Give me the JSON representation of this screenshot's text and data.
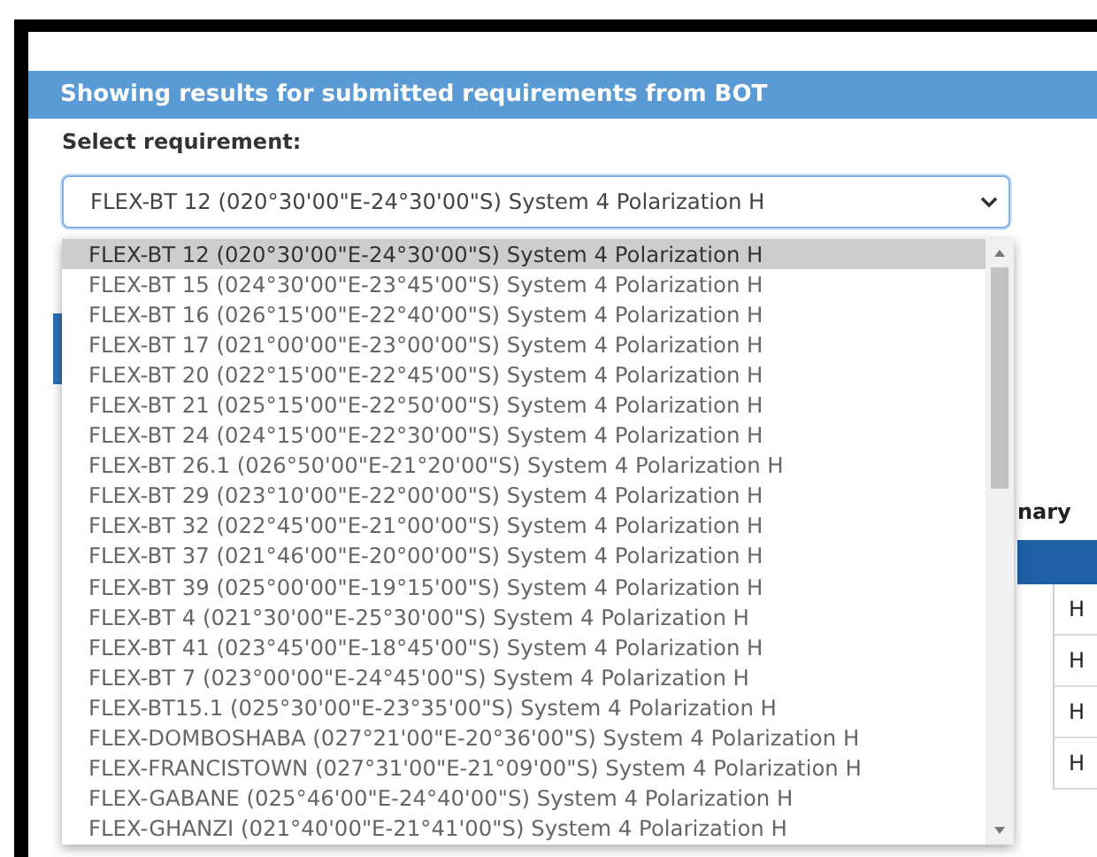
{
  "panel": {
    "title": "Showing results for submitted requirements from BOT"
  },
  "requirement": {
    "label": "Select requirement:",
    "value": "FLEX-BT 12 (020°30'00\"E-24°30'00\"S) System 4 Polarization H"
  },
  "options": [
    {
      "label": "FLEX-BT 12 (020°30'00\"E-24°30'00\"S) System 4 Polarization H",
      "selected": true
    },
    {
      "label": "FLEX-BT 15 (024°30'00\"E-23°45'00\"S) System 4 Polarization H",
      "selected": false
    },
    {
      "label": "FLEX-BT 16 (026°15'00\"E-22°40'00\"S) System 4 Polarization H",
      "selected": false
    },
    {
      "label": "FLEX-BT 17 (021°00'00\"E-23°00'00\"S) System 4 Polarization H",
      "selected": false
    },
    {
      "label": "FLEX-BT 20 (022°15'00\"E-22°45'00\"S) System 4 Polarization H",
      "selected": false
    },
    {
      "label": "FLEX-BT 21 (025°15'00\"E-22°50'00\"S) System 4 Polarization H",
      "selected": false
    },
    {
      "label": "FLEX-BT 24 (024°15'00\"E-22°30'00\"S) System 4 Polarization H",
      "selected": false
    },
    {
      "label": "FLEX-BT 26.1 (026°50'00\"E-21°20'00\"S) System 4 Polarization H",
      "selected": false
    },
    {
      "label": "FLEX-BT 29 (023°10'00\"E-22°00'00\"S) System 4 Polarization H",
      "selected": false
    },
    {
      "label": "FLEX-BT 32 (022°45'00\"E-21°00'00\"S) System 4 Polarization H",
      "selected": false
    },
    {
      "label": "FLEX-BT 37 (021°46'00\"E-20°00'00\"S) System 4 Polarization H",
      "selected": false
    },
    {
      "label": "FLEX-BT 39 (025°00'00\"E-19°15'00\"S) System 4 Polarization H",
      "selected": false
    },
    {
      "label": "FLEX-BT 4 (021°30'00\"E-25°30'00\"S) System 4 Polarization H",
      "selected": false
    },
    {
      "label": "FLEX-BT 41 (023°45'00\"E-18°45'00\"S) System 4 Polarization H",
      "selected": false
    },
    {
      "label": "FLEX-BT 7 (023°00'00\"E-24°45'00\"S) System 4 Polarization H",
      "selected": false
    },
    {
      "label": "FLEX-BT15.1 (025°30'00\"E-23°35'00\"S) System 4 Polarization H",
      "selected": false
    },
    {
      "label": "FLEX-DOMBOSHABA (027°21'00\"E-20°36'00\"S) System 4 Polarization H",
      "selected": false
    },
    {
      "label": "FLEX-FRANCISTOWN (027°31'00\"E-21°09'00\"S) System 4 Polarization H",
      "selected": false
    },
    {
      "label": "FLEX-GABANE (025°46'00\"E-24°40'00\"S) System 4 Polarization H",
      "selected": false
    },
    {
      "label": "FLEX-GHANZI (021°40'00\"E-21°41'00\"S) System 4 Polarization H",
      "selected": false
    }
  ],
  "background": {
    "heading": "nary",
    "cells": [
      "H",
      "H",
      "H",
      "H"
    ]
  }
}
